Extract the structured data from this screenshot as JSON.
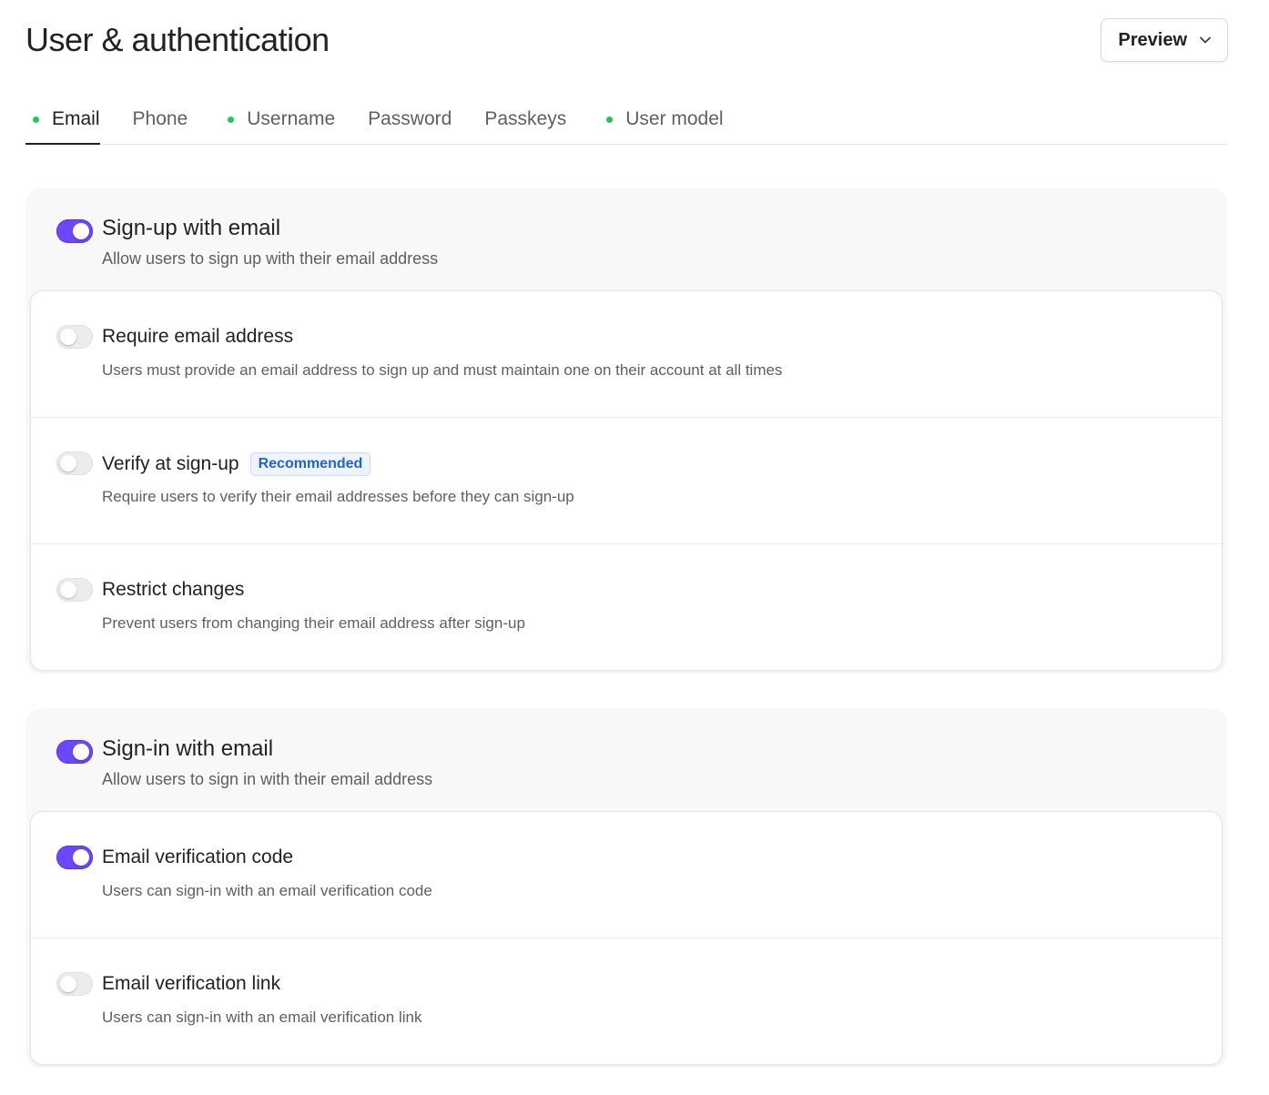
{
  "page": {
    "title": "User & authentication"
  },
  "preview": {
    "label": "Preview"
  },
  "tabs": [
    {
      "label": "Email",
      "active": true,
      "dot": true
    },
    {
      "label": "Phone",
      "active": false,
      "dot": false
    },
    {
      "label": "Username",
      "active": false,
      "dot": true
    },
    {
      "label": "Password",
      "active": false,
      "dot": false
    },
    {
      "label": "Passkeys",
      "active": false,
      "dot": false
    },
    {
      "label": "User model",
      "active": false,
      "dot": true
    }
  ],
  "sign_up": {
    "title": "Sign-up with email",
    "description": "Allow users to sign up with their email address",
    "enabled": true,
    "options": [
      {
        "title": "Require email address",
        "description": "Users must provide an email address to sign up and must maintain one on their account at all times",
        "enabled": false
      },
      {
        "title": "Verify at sign-up",
        "badge": "Recommended",
        "description": "Require users to verify their email addresses before they can sign-up",
        "enabled": false
      },
      {
        "title": "Restrict changes",
        "description": "Prevent users from changing their email address after sign-up",
        "enabled": false
      }
    ]
  },
  "sign_in": {
    "title": "Sign-in with email",
    "description": "Allow users to sign in with their email address",
    "enabled": true,
    "options": [
      {
        "title": "Email verification code",
        "description": "Users can sign-in with an email verification code",
        "enabled": true
      },
      {
        "title": "Email verification link",
        "description": "Users can sign-in with an email verification link",
        "enabled": false
      }
    ]
  },
  "colors": {
    "accent": "#6c47ff",
    "status_dot": "#22c55e",
    "badge_text": "#2563c9"
  },
  "icons": {
    "preview_dropdown": "chevron-down-icon",
    "tab_status": "green-dot"
  }
}
